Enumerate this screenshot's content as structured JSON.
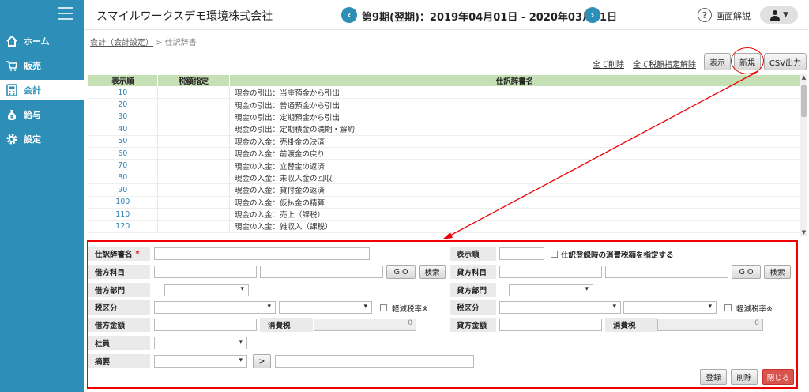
{
  "sidebar": {
    "items": [
      {
        "label": "ホーム",
        "icon": "home-icon"
      },
      {
        "label": "販売",
        "icon": "cart-icon"
      },
      {
        "label": "会計",
        "icon": "calculator-icon"
      },
      {
        "label": "給与",
        "icon": "money-bag-icon"
      },
      {
        "label": "設定",
        "icon": "gear-icon"
      }
    ],
    "active_index": 2
  },
  "header": {
    "company": "スマイルワークスデモ環境株式会社",
    "period": "第9期(翌期)：2019年04月01日 - 2020年03月31日",
    "help_label": "画面解説"
  },
  "breadcrumb": {
    "parent": "会計（会計設定）",
    "separator": ">",
    "current": "仕訳辞書"
  },
  "toolbar": {
    "delete_all": "全て削除",
    "clear_tax": "全て税額指定解除",
    "show": "表示",
    "new": "新規",
    "csv": "CSV出力"
  },
  "table": {
    "headers": [
      "表示順",
      "税額指定",
      "仕訳辞書名"
    ],
    "rows": [
      {
        "order": "10",
        "tax": "",
        "name": "現金の引出：当座預金から引出"
      },
      {
        "order": "20",
        "tax": "",
        "name": "現金の引出：普通預金から引出"
      },
      {
        "order": "30",
        "tax": "",
        "name": "現金の引出：定期預金から引出"
      },
      {
        "order": "40",
        "tax": "",
        "name": "現金の引出：定期積金の満期・解約"
      },
      {
        "order": "50",
        "tax": "",
        "name": "現金の入金：売掛金の決済"
      },
      {
        "order": "60",
        "tax": "",
        "name": "現金の入金：前渡金の戻り"
      },
      {
        "order": "70",
        "tax": "",
        "name": "現金の入金：立替金の返済"
      },
      {
        "order": "80",
        "tax": "",
        "name": "現金の入金：未収入金の回収"
      },
      {
        "order": "90",
        "tax": "",
        "name": "現金の入金：貸付金の返済"
      },
      {
        "order": "100",
        "tax": "",
        "name": "現金の入金：仮払金の精算"
      },
      {
        "order": "110",
        "tax": "",
        "name": "現金の入金：売上（課税）"
      },
      {
        "order": "120",
        "tax": "",
        "name": "現金の入金：雑収入（課税）"
      }
    ]
  },
  "form": {
    "journal_name_label": "仕訳辞書名",
    "required_mark": "*",
    "display_order_label": "表示順",
    "specify_tax_label": "仕訳登録時の消費税額を指定する",
    "debit_account_label": "借方科目",
    "credit_account_label": "貸方科目",
    "go_label": "G O",
    "search_label": "検索",
    "debit_dept_label": "借方部門",
    "credit_dept_label": "貸方部門",
    "tax_class_label": "税区分",
    "reduced_rate_label": "軽減税率※",
    "debit_amount_label": "借方金額",
    "credit_amount_label": "貸方金額",
    "consumption_tax_label": "消費税",
    "debit_tax_value": "0",
    "credit_tax_value": "0",
    "employee_label": "社員",
    "summary_label": "摘要",
    "arrow_label": ">",
    "register_label": "登録",
    "delete_label": "削除",
    "close_label": "閉じる"
  },
  "colors": {
    "sidebar": "#2d8fb8",
    "table_header": "#c4e0b4",
    "annotation": "#e00000",
    "close_button": "#d9534f"
  }
}
